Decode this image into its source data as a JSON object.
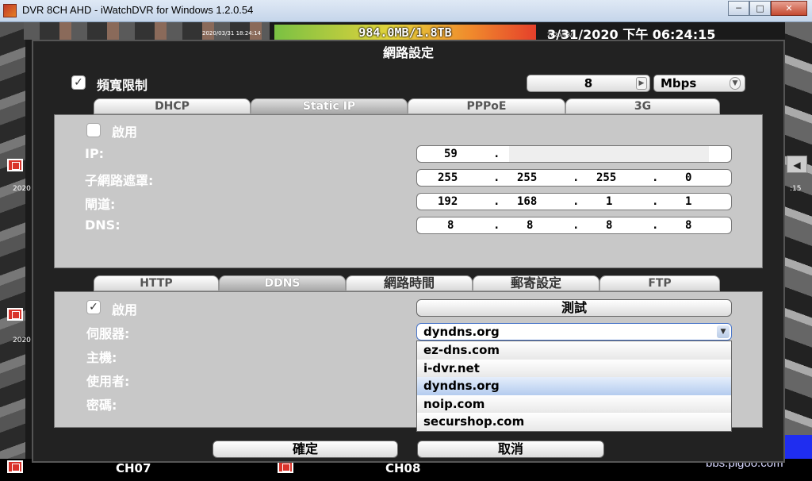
{
  "window": {
    "title": "DVR 8CH AHD - iWatchDVR for Windows 1.2.0.54",
    "minimize": "─",
    "maximize": "□",
    "close": "✕"
  },
  "background": {
    "hdd_usage": "984.0MB/1.8TB",
    "datetime": "3/31/2020 下午 06:24:15",
    "cam_timestamp": "2020/03/31 18:24:14",
    "cam_timestamp_partial": "2020/03/3",
    "side_labels": [
      "2020",
      "2020",
      ":15"
    ],
    "channels": [
      "CH07",
      "CH08"
    ],
    "watermark": "bbs.pigoo.com"
  },
  "dialog": {
    "title": "網路設定",
    "bandwidth": {
      "label": "頻寬限制",
      "checked": true,
      "value": "8",
      "unit": "Mbps"
    },
    "net_tabs": [
      {
        "label": "DHCP",
        "active": false
      },
      {
        "label": "Static IP",
        "active": true
      },
      {
        "label": "PPPoE",
        "active": false
      },
      {
        "label": "3G",
        "active": false
      }
    ],
    "static_ip": {
      "enable_label": "啟用",
      "enable_checked": false,
      "fields": [
        {
          "label": "IP:",
          "octets": [
            "59",
            "",
            "",
            ""
          ]
        },
        {
          "label": "子網路遮罩:",
          "octets": [
            "255",
            "255",
            "255",
            "0"
          ]
        },
        {
          "label": "閘道:",
          "octets": [
            "192",
            "168",
            "1",
            "1"
          ]
        },
        {
          "label": "DNS:",
          "octets": [
            "8",
            "8",
            "8",
            "8"
          ]
        }
      ]
    },
    "svc_tabs": [
      {
        "label": "HTTP",
        "active": false
      },
      {
        "label": "DDNS",
        "active": true
      },
      {
        "label": "網路時間",
        "active": false
      },
      {
        "label": "郵寄設定",
        "active": false
      },
      {
        "label": "FTP",
        "active": false
      }
    ],
    "ddns": {
      "enable_label": "啟用",
      "enable_checked": true,
      "test_button": "測試",
      "server_label": "伺服器:",
      "host_label": "主機:",
      "user_label": "使用者:",
      "password_label": "密碼:",
      "server_value": "dyndns.org",
      "server_options": [
        "ez-dns.com",
        "i-dvr.net",
        "dyndns.org",
        "noip.com",
        "securshop.com"
      ]
    },
    "ok_button": "確定",
    "cancel_button": "取消"
  }
}
